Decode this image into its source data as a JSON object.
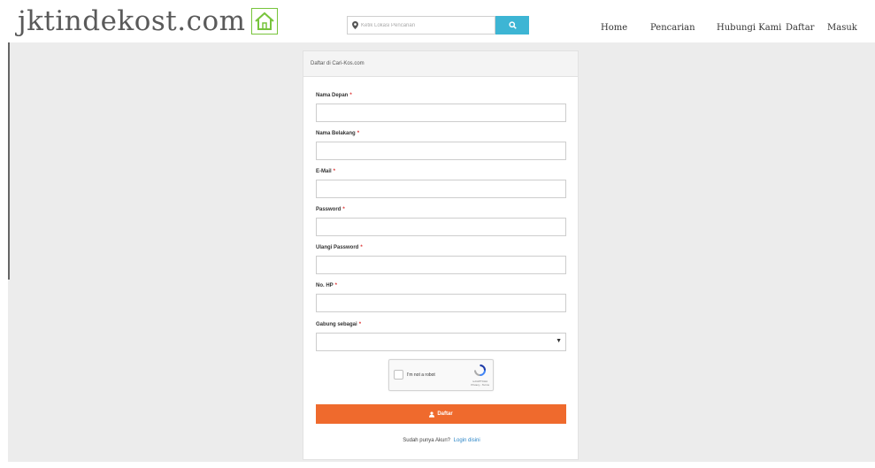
{
  "logo": {
    "text": "jktindekost.com",
    "icon": "house-icon"
  },
  "search": {
    "placeholder": "Ketik Lokasi Pencarian",
    "icon": "map-pin-icon",
    "button_icon": "search-icon"
  },
  "nav": [
    "Home",
    "Pencarian",
    "Hubungi Kami",
    "Daftar",
    "Masuk"
  ],
  "form": {
    "title": "Daftar di Cari-Kos.com",
    "required_mark": "*",
    "fields": [
      {
        "label": "Nama Depan",
        "value": ""
      },
      {
        "label": "Nama Belakang",
        "value": ""
      },
      {
        "label": "E-Mail",
        "value": ""
      },
      {
        "label": "Password",
        "value": ""
      },
      {
        "label": "Ulangi Password",
        "value": ""
      },
      {
        "label": "No. HP",
        "value": ""
      }
    ],
    "join_as": {
      "label": "Gabung sebagai",
      "selected": ""
    },
    "captcha": {
      "label": "I'm not a robot",
      "brand": "reCAPTCHA",
      "sub": "Privacy - Terms"
    },
    "submit_label": "Daftar",
    "login_prompt": "Sudah punya Akun?",
    "login_link": "Login disini"
  },
  "colors": {
    "accent": "#ef6a2d",
    "search_button": "#3db5d4",
    "link": "#2c86c7",
    "logo_green": "#77c43b",
    "required": "#d33333"
  }
}
